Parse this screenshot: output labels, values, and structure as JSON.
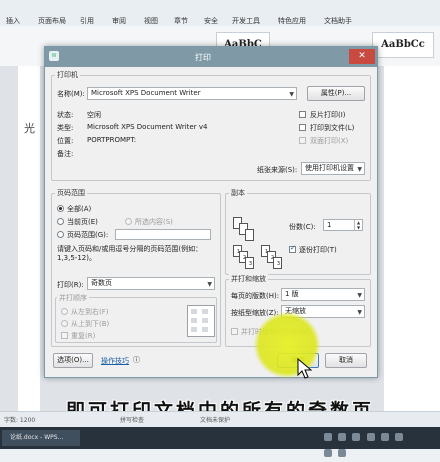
{
  "ribbon": {
    "tabs": [
      "插入",
      "页面布局",
      "引用",
      "审阅",
      "视图",
      "章节",
      "安全",
      "开发工具",
      "特色应用",
      "文档助手"
    ],
    "styles": [
      "AaBbC",
      "AaBbCc"
    ]
  },
  "document": {
    "glyph": "光"
  },
  "dialog": {
    "title": "打印",
    "close_label": "✕",
    "printer": {
      "group_title": "打印机",
      "name_label": "名称(M):",
      "name_value": "Microsoft XPS Document Writer",
      "properties_label": "属性(P)...",
      "status_label": "状态:",
      "status_value": "空闲",
      "type_label": "类型:",
      "type_value": "Microsoft XPS Document Writer v4",
      "location_label": "位置:",
      "location_value": "PORTPROMPT:",
      "comment_label": "备注:",
      "reverse_label": "反片打印(I)",
      "to_file_label": "打印到文件(L)",
      "duplex_label": "双面打印(X)",
      "paper_source_label": "纸张来源(S):",
      "paper_source_value": "使用打印机设置"
    },
    "page_range": {
      "group_title": "页码范围",
      "all_label": "全部(A)",
      "current_label": "当前页(E)",
      "selection_label": "所选内容(S)",
      "pages_label": "页码范围(G):",
      "hint": "请键入页码和/或用逗号分隔的页码范围(例如：1,3,5-12)。",
      "print_label": "打印(R):",
      "print_value": "奇数页",
      "order_title": "并打顺序",
      "order_lr": "从左到右(F)",
      "order_tb": "从上到下(B)",
      "order_repeat": "重复(R)"
    },
    "copies": {
      "group_title": "副本",
      "count_label": "份数(C):",
      "count_value": "1",
      "collate_label": "逐份打印(T)",
      "collate_checked": true
    },
    "zoom": {
      "group_title": "并打和缩放",
      "pages_per_sheet_label": "每页的版数(H):",
      "pages_per_sheet_value": "1 版",
      "scale_label": "按纸型缩放(Z):",
      "scale_value": "无缩放",
      "draw_lines_label": "并打时绘制分隔线(D)"
    },
    "options_label": "选项(O)...",
    "tips_label": "操作技巧",
    "ok_label": "确定",
    "cancel_label": "取消"
  },
  "status": {
    "page_info": "字数: 1200",
    "extra": "拼写检查",
    "protect": "文档未保护"
  },
  "taskbar": {
    "task_label": "论纸.docx - WPS..."
  },
  "caption": "即可打印文档中的所有的奇数页"
}
